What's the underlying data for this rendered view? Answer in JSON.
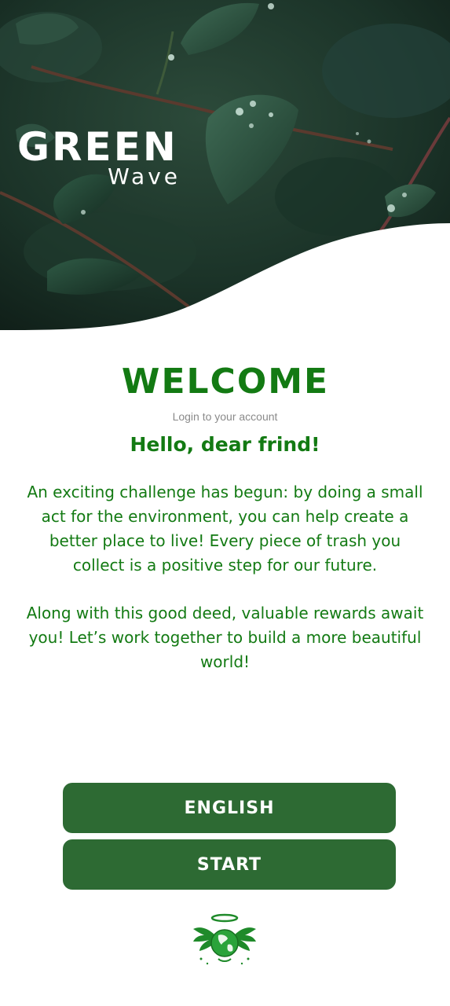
{
  "brand": {
    "title": "GREEN",
    "subtitle": "Wave"
  },
  "main": {
    "heading": "WELCOME",
    "subheading": "Login to your account",
    "greeting": "Hello, dear frind!",
    "paragraphs": [
      "An exciting challenge has begun: by doing a small act for the environment, you can help create a better place to live! Every piece of trash you collect is a positive step for our future.",
      "Along with this good deed, valuable rewards await you! Let’s work together to build a more beautiful world!"
    ]
  },
  "buttons": {
    "language_label": "ENGLISH",
    "start_label": "START"
  },
  "icons": {
    "hero": "leaves-photo",
    "logo": "angel-earth-logo"
  },
  "colors": {
    "primary_green": "#137a13",
    "button_green": "#2d6a33",
    "muted_text": "#8a8a8a",
    "background": "#ffffff"
  }
}
